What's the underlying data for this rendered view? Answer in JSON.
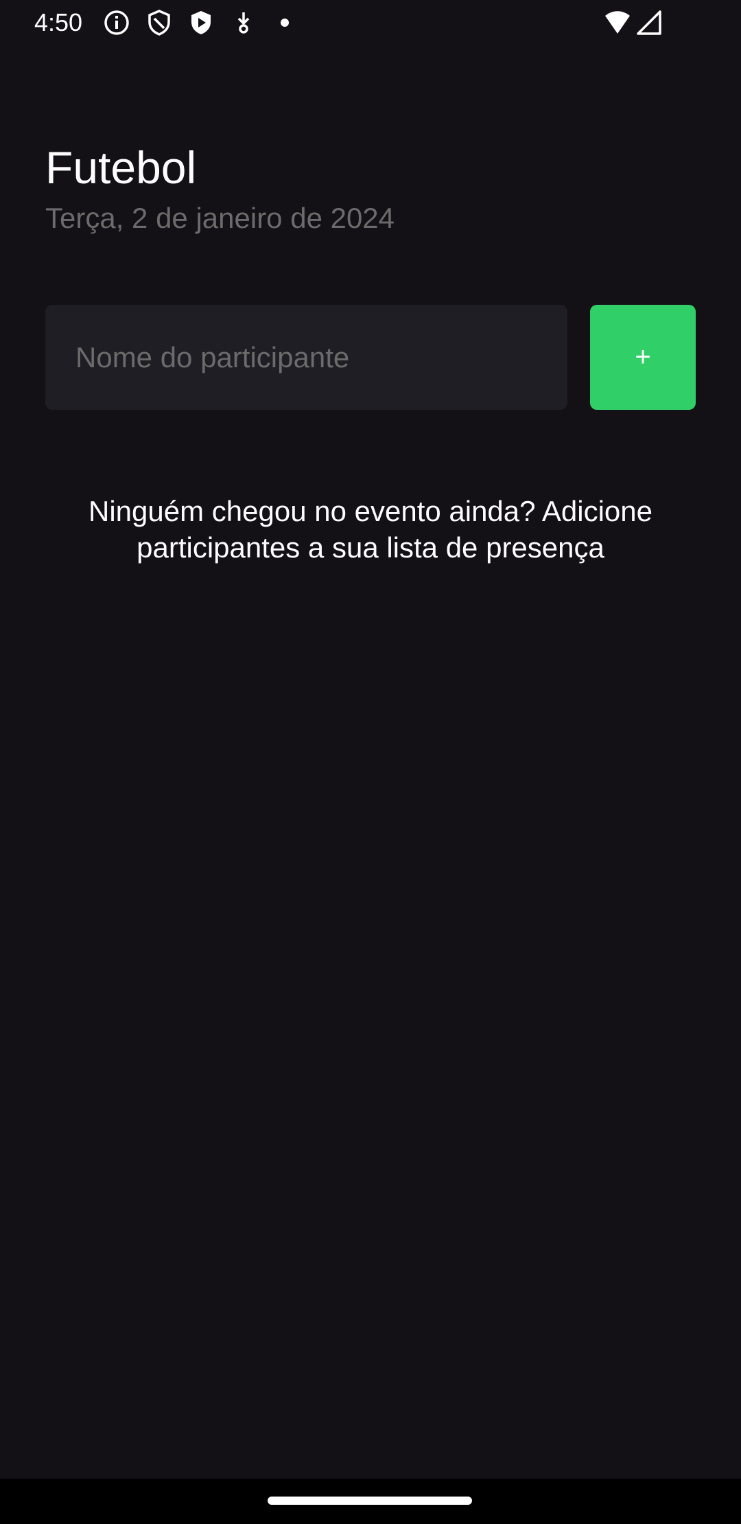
{
  "status_bar": {
    "time": "4:50",
    "left_icons": [
      "info-icon",
      "shield-icon",
      "play-shield-icon",
      "download-icon",
      "dot-icon"
    ],
    "right_icons": [
      "wifi-icon",
      "cellular-signal-icon"
    ]
  },
  "event": {
    "title": "Futebol",
    "date": "Terça, 2 de janeiro de 2024"
  },
  "form": {
    "input_placeholder": "Nome do participante",
    "input_value": "",
    "add_button_label": "+"
  },
  "empty_state": {
    "message": "Ninguém chegou no evento ainda? Adicione participantes a sua lista de presença"
  },
  "colors": {
    "background": "#131016",
    "input_background": "#1f1e25",
    "accent_green": "#31cf67",
    "muted_text": "#6b6b6b",
    "text": "#fdfcfe"
  }
}
